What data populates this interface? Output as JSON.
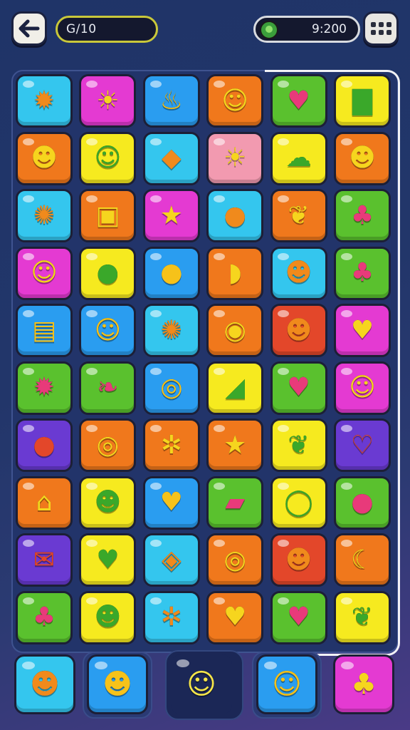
{
  "header": {
    "back_icon": "back-arrow-icon",
    "counter_text": "G/10",
    "score_text": "9:200",
    "score_icon": "green-gem-icon",
    "menu_icon": "grid-menu-icon"
  },
  "colors": {
    "blue": "#2a9df0",
    "cyan": "#34c6ee",
    "magenta": "#e43ad2",
    "orange": "#f0781c",
    "green": "#5ac12e",
    "yellow": "#f6ea1f",
    "pink": "#f29ab0",
    "purple": "#6a3ad2",
    "red": "#e3472a"
  },
  "grid": [
    [
      {
        "color": "cyan",
        "icon": "sun-star-icon",
        "glyph": "✹"
      },
      {
        "color": "magenta",
        "icon": "sun-face-icon",
        "glyph": "☀"
      },
      {
        "color": "blue",
        "icon": "flame-icon",
        "glyph": "♨"
      },
      {
        "color": "orange",
        "icon": "smile-block-icon",
        "glyph": "☺"
      },
      {
        "color": "green",
        "icon": "heart-gem-icon",
        "glyph": "♥"
      },
      {
        "color": "yellow",
        "icon": "green-block-icon",
        "glyph": "▇"
      }
    ],
    [
      {
        "color": "orange",
        "icon": "monkey-face-icon",
        "glyph": "☻"
      },
      {
        "color": "yellow",
        "icon": "fish-smile-icon",
        "glyph": "☺"
      },
      {
        "color": "cyan",
        "icon": "crystal-icon",
        "glyph": "◆"
      },
      {
        "color": "pink",
        "icon": "sun-smile-icon",
        "glyph": "☀"
      },
      {
        "color": "yellow",
        "icon": "ghost-icon",
        "glyph": "☁"
      },
      {
        "color": "orange",
        "icon": "green-fish-icon",
        "glyph": "☻"
      }
    ],
    [
      {
        "color": "cyan",
        "icon": "sun-icon",
        "glyph": "✺"
      },
      {
        "color": "orange",
        "icon": "green-box-icon",
        "glyph": "▣"
      },
      {
        "color": "magenta",
        "icon": "star-face-icon",
        "glyph": "★"
      },
      {
        "color": "cyan",
        "icon": "lollipop-icon",
        "glyph": "●"
      },
      {
        "color": "orange",
        "icon": "leaf-icon",
        "glyph": "❦"
      },
      {
        "color": "green",
        "icon": "leaf-cluster-icon",
        "glyph": "♣"
      }
    ],
    [
      {
        "color": "magenta",
        "icon": "yellow-fish-icon",
        "glyph": "☺"
      },
      {
        "color": "yellow",
        "icon": "purple-fruit-icon",
        "glyph": "●"
      },
      {
        "color": "blue",
        "icon": "yellow-ball-icon",
        "glyph": "●"
      },
      {
        "color": "orange",
        "icon": "blue-fish-icon",
        "glyph": "◗"
      },
      {
        "color": "cyan",
        "icon": "red-bird-icon",
        "glyph": "☻"
      },
      {
        "color": "green",
        "icon": "broccoli-icon",
        "glyph": "♣"
      }
    ],
    [
      {
        "color": "blue",
        "icon": "jar-icon",
        "glyph": "▤"
      },
      {
        "color": "blue",
        "icon": "yellow-chick-icon",
        "glyph": "☺"
      },
      {
        "color": "cyan",
        "icon": "swirl-sun-icon",
        "glyph": "✺"
      },
      {
        "color": "orange",
        "icon": "yellow-drop-icon",
        "glyph": "◉"
      },
      {
        "color": "red",
        "icon": "orange-fish-icon",
        "glyph": "☻"
      },
      {
        "color": "magenta",
        "icon": "red-fish-icon",
        "glyph": "♥"
      }
    ],
    [
      {
        "color": "green",
        "icon": "swirl-star-icon",
        "glyph": "✹"
      },
      {
        "color": "green",
        "icon": "green-leaf-icon",
        "glyph": "❧"
      },
      {
        "color": "blue",
        "icon": "blue-eye-icon",
        "glyph": "◎"
      },
      {
        "color": "yellow",
        "icon": "pencil-block-icon",
        "glyph": "◢"
      },
      {
        "color": "green",
        "icon": "heart-icon",
        "glyph": "♥"
      },
      {
        "color": "magenta",
        "icon": "cat-face-icon",
        "glyph": "☺"
      }
    ],
    [
      {
        "color": "purple",
        "icon": "apple-icon",
        "glyph": "●"
      },
      {
        "color": "orange",
        "icon": "bubble-icon",
        "glyph": "◎"
      },
      {
        "color": "orange",
        "icon": "gear-icon",
        "glyph": "✲"
      },
      {
        "color": "orange",
        "icon": "blue-star-icon",
        "glyph": "★"
      },
      {
        "color": "yellow",
        "icon": "green-leaf-icon",
        "glyph": "❦"
      },
      {
        "color": "purple",
        "icon": "white-heart-icon",
        "glyph": "♡"
      }
    ],
    [
      {
        "color": "orange",
        "icon": "house-icon",
        "glyph": "⌂"
      },
      {
        "color": "yellow",
        "icon": "red-fish-icon",
        "glyph": "☻"
      },
      {
        "color": "blue",
        "icon": "red-heart-icon",
        "glyph": "♥"
      },
      {
        "color": "green",
        "icon": "pink-candy-icon",
        "glyph": "▰"
      },
      {
        "color": "yellow",
        "icon": "white-donut-icon",
        "glyph": "◯"
      },
      {
        "color": "green",
        "icon": "blue-bird-icon",
        "glyph": "●"
      }
    ],
    [
      {
        "color": "purple",
        "icon": "envelope-icon",
        "glyph": "✉"
      },
      {
        "color": "yellow",
        "icon": "purple-heart-icon",
        "glyph": "♥"
      },
      {
        "color": "cyan",
        "icon": "green-cube-icon",
        "glyph": "◈"
      },
      {
        "color": "orange",
        "icon": "blue-snail-icon",
        "glyph": "◎"
      },
      {
        "color": "red",
        "icon": "orange-fish-icon",
        "glyph": "☻"
      },
      {
        "color": "orange",
        "icon": "pink-moon-icon",
        "glyph": "☾"
      }
    ],
    [
      {
        "color": "green",
        "icon": "green-frog-icon",
        "glyph": "♣"
      },
      {
        "color": "yellow",
        "icon": "green-fish-icon",
        "glyph": "☻"
      },
      {
        "color": "cyan",
        "icon": "blue-gear-icon",
        "glyph": "✲"
      },
      {
        "color": "orange",
        "icon": "green-heart-icon",
        "glyph": "♥"
      },
      {
        "color": "green",
        "icon": "pink-heart-icon",
        "glyph": "♥"
      },
      {
        "color": "yellow",
        "icon": "green-leaf-icon",
        "glyph": "❦"
      }
    ]
  ],
  "tray": [
    {
      "color": "cyan",
      "icon": "red-fish-icon",
      "glyph": "☻"
    },
    {
      "color": "blue",
      "icon": "purple-fish-icon",
      "glyph": "☻"
    },
    {
      "color": "active",
      "icon": "yellow-smile-icon",
      "glyph": "☺"
    },
    {
      "color": "blue",
      "icon": "yellow-fish-icon",
      "glyph": "☺"
    },
    {
      "color": "magenta",
      "icon": "green-bird-icon",
      "glyph": "♣"
    }
  ]
}
